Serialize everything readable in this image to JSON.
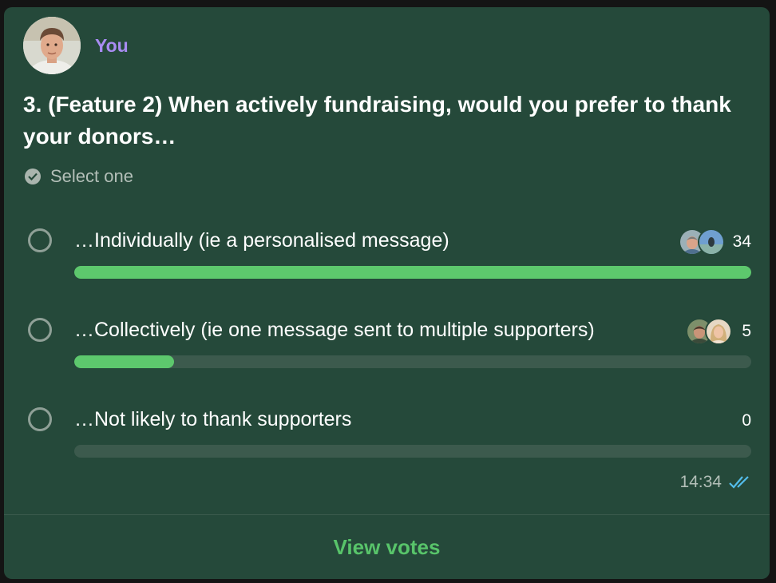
{
  "message": {
    "sender": "You",
    "question": "3. (Feature 2) When actively fundraising, would you prefer to thank your donors…",
    "hint": "Select one",
    "time": "14:34",
    "read_status": "double-check-icon",
    "view_votes_label": "View votes"
  },
  "options": [
    {
      "label": "…Individually (ie a personalised message)",
      "count": "34",
      "fraction": 1.0
    },
    {
      "label": "…Collectively (ie one message sent to multiple supporters)",
      "count": "5",
      "fraction": 0.147
    },
    {
      "label": "…Not likely to thank supporters",
      "count": "0",
      "fraction": 0.0
    }
  ],
  "colors": {
    "card_bg": "#25493a",
    "sender": "#a88cf2",
    "bar_fill": "#5dc86d",
    "bar_track": "#3c5a4d",
    "action": "#58c46a",
    "read_tick": "#53bdeb"
  }
}
